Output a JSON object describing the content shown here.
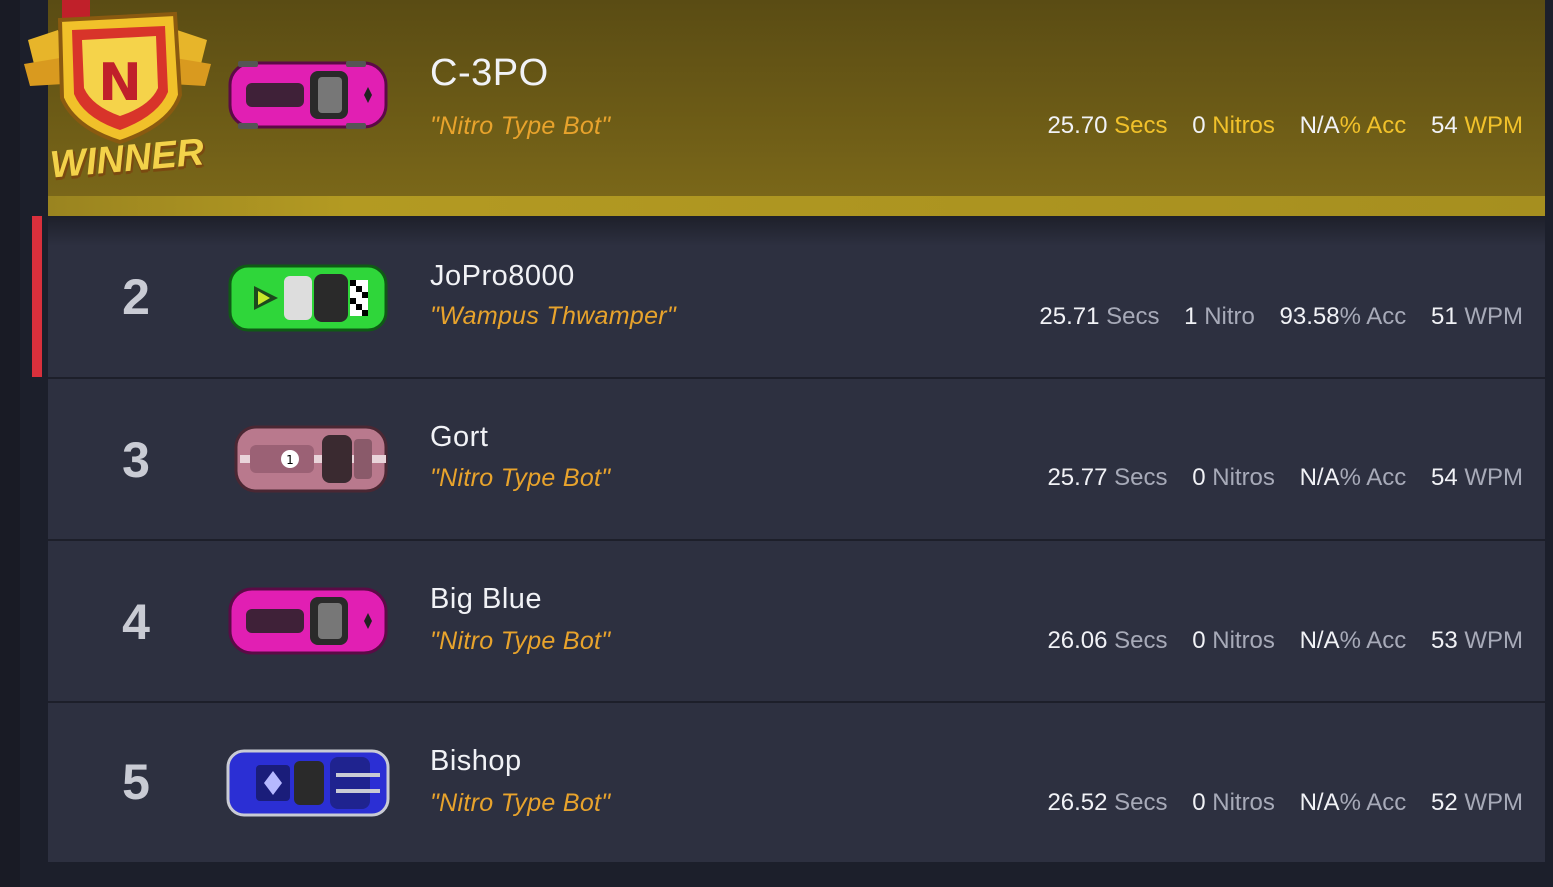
{
  "badge": {
    "text": "WINNER",
    "letter": "N"
  },
  "racers": [
    {
      "place": "",
      "name": "C-3PO",
      "tag": "\"Nitro Type Bot\"",
      "time": "25.70",
      "time_unit": "Secs",
      "nitros": "0",
      "nitros_unit": "Nitros",
      "acc": "N/A",
      "acc_unit": "% Acc",
      "wpm": "54",
      "wpm_unit": "WPM",
      "car_color": "#e11fb3"
    },
    {
      "place": "2",
      "name": "JoPro8000",
      "tag": "\"Wampus Thwamper\"",
      "time": "25.71",
      "time_unit": "Secs",
      "nitros": "1",
      "nitros_unit": "Nitro",
      "acc": "93.58",
      "acc_unit": "% Acc",
      "wpm": "51",
      "wpm_unit": "WPM",
      "car_color": "#2fd63a"
    },
    {
      "place": "3",
      "name": "Gort",
      "tag": "\"Nitro Type Bot\"",
      "time": "25.77",
      "time_unit": "Secs",
      "nitros": "0",
      "nitros_unit": "Nitros",
      "acc": "N/A",
      "acc_unit": "% Acc",
      "wpm": "54",
      "wpm_unit": "WPM",
      "car_color": "#b9798d"
    },
    {
      "place": "4",
      "name": "Big Blue",
      "tag": "\"Nitro Type Bot\"",
      "time": "26.06",
      "time_unit": "Secs",
      "nitros": "0",
      "nitros_unit": "Nitros",
      "acc": "N/A",
      "acc_unit": "% Acc",
      "wpm": "53",
      "wpm_unit": "WPM",
      "car_color": "#e11fb3"
    },
    {
      "place": "5",
      "name": "Bishop",
      "tag": "\"Nitro Type Bot\"",
      "time": "26.52",
      "time_unit": "Secs",
      "nitros": "0",
      "nitros_unit": "Nitros",
      "acc": "N/A",
      "acc_unit": "% Acc",
      "wpm": "52",
      "wpm_unit": "WPM",
      "car_color": "#2b2fd4"
    }
  ]
}
